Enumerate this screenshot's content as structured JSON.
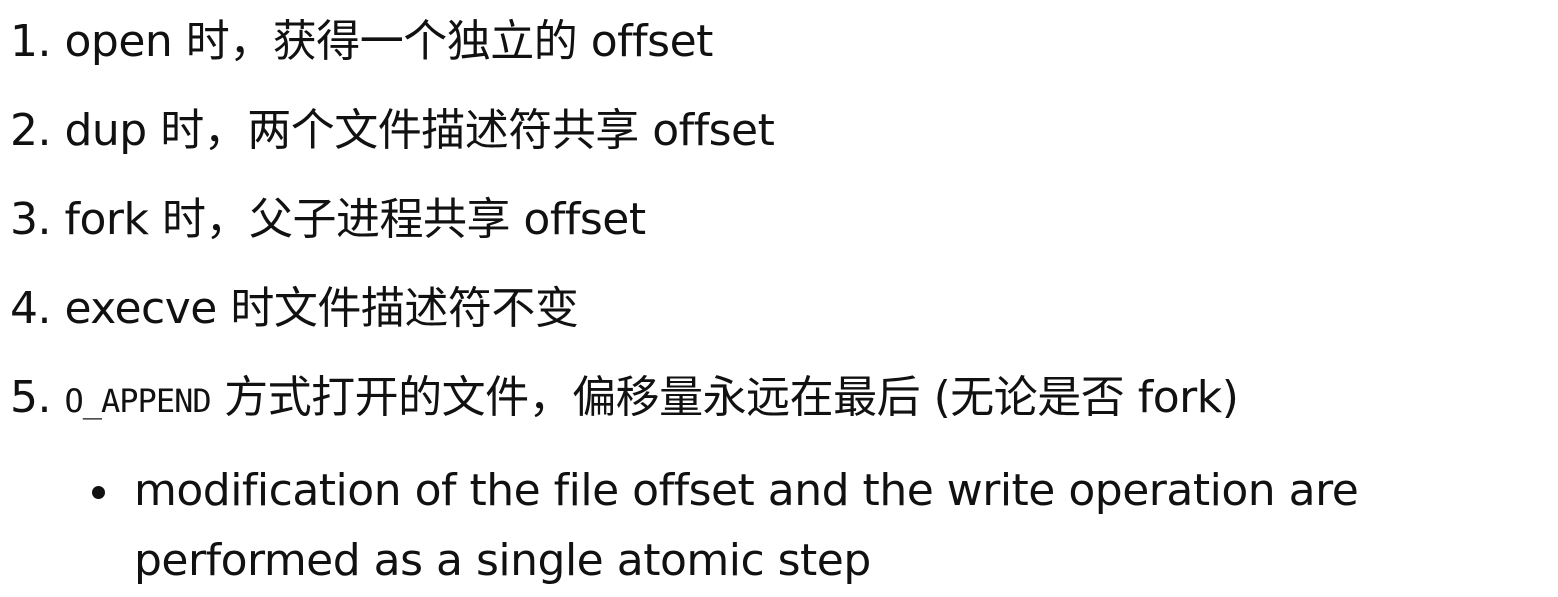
{
  "list": {
    "items": [
      {
        "number": "1.",
        "text": "open 时，获得一个独立的 offset"
      },
      {
        "number": "2.",
        "text": "dup 时，两个文件描述符共享 offset"
      },
      {
        "number": "3.",
        "text": "fork 时，父子进程共享 offset"
      },
      {
        "number": "4.",
        "text": "execve 时文件描述符不变"
      },
      {
        "number": "5.",
        "code": "O_APPEND",
        "text": " 方式打开的文件，偏移量永远在最后 (无论是否 fork)"
      }
    ],
    "sub_items": [
      {
        "line1": "modification of the file offset and the write operation are",
        "line2": "performed as a single atomic step"
      }
    ]
  }
}
